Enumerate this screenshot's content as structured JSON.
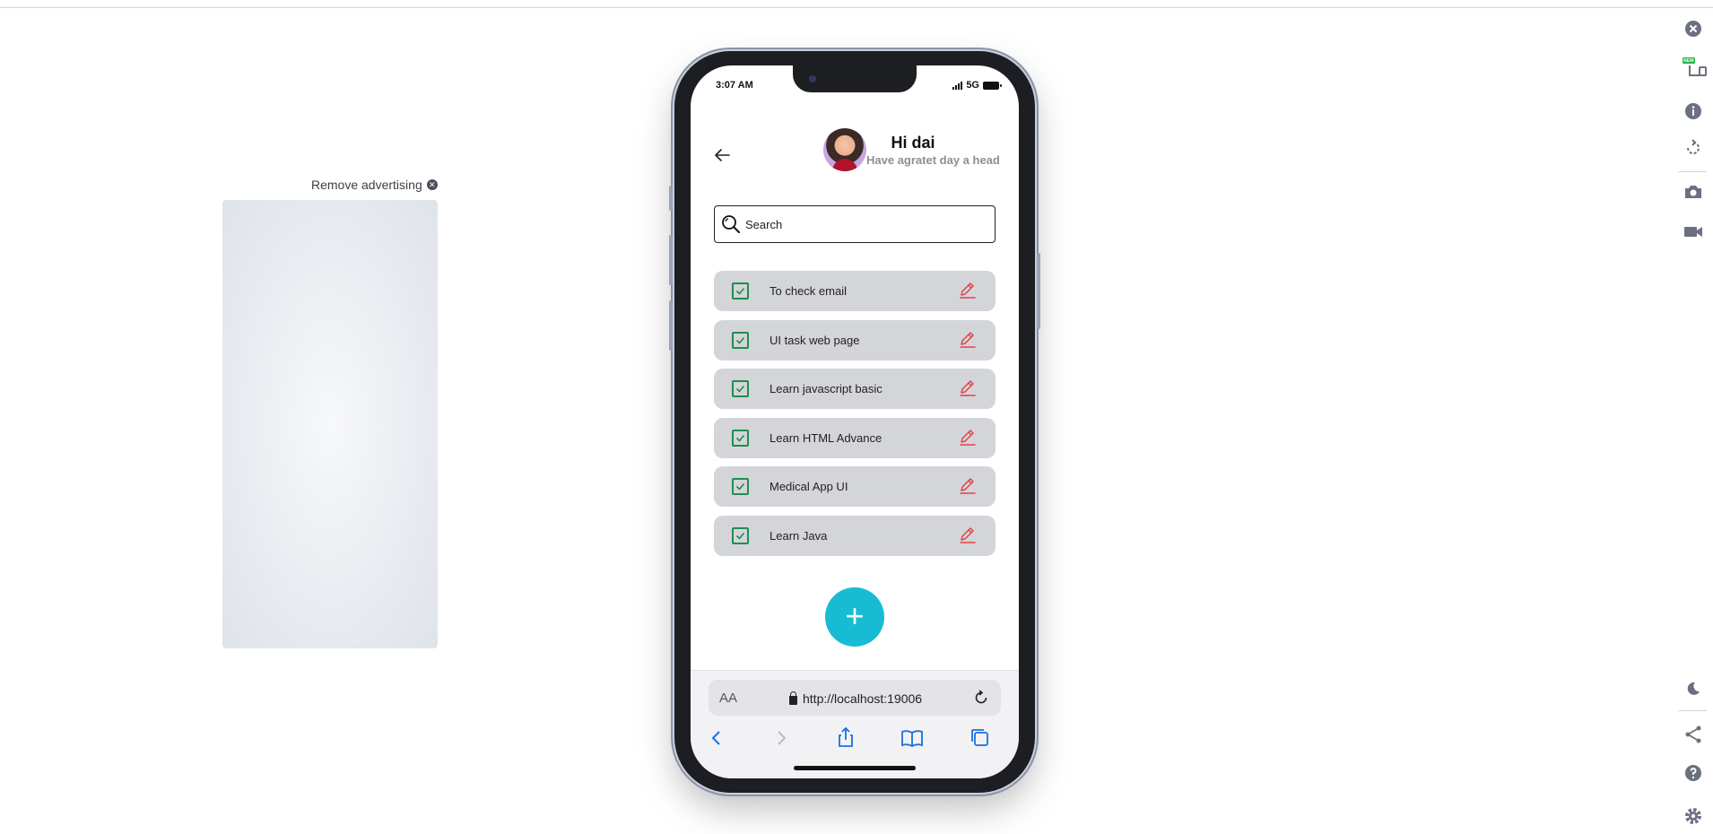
{
  "ad": {
    "remove_label": "Remove advertising"
  },
  "phone": {
    "status": {
      "time": "3:07 AM",
      "network": "5G"
    },
    "header": {
      "greeting": "Hi dai",
      "subtitle": "Have agratet day a head"
    },
    "search": {
      "placeholder": "Search"
    },
    "tasks": [
      {
        "label": "To check email",
        "checked": true
      },
      {
        "label": "UI task web page",
        "checked": true
      },
      {
        "label": "Learn javascript basic",
        "checked": true
      },
      {
        "label": "Learn HTML Advance",
        "checked": true
      },
      {
        "label": "Medical App UI",
        "checked": true
      },
      {
        "label": "Learn Java",
        "checked": true
      }
    ],
    "fab_label": "+",
    "browser": {
      "aa_label": "AA",
      "url": "http://localhost:19006"
    }
  },
  "toolbar": {
    "new_badge": "NEW"
  },
  "colors": {
    "accent": "#17bcd4",
    "check": "#1e8e4e",
    "edit": "#e0424a",
    "task_bg": "#d4d5d9"
  }
}
